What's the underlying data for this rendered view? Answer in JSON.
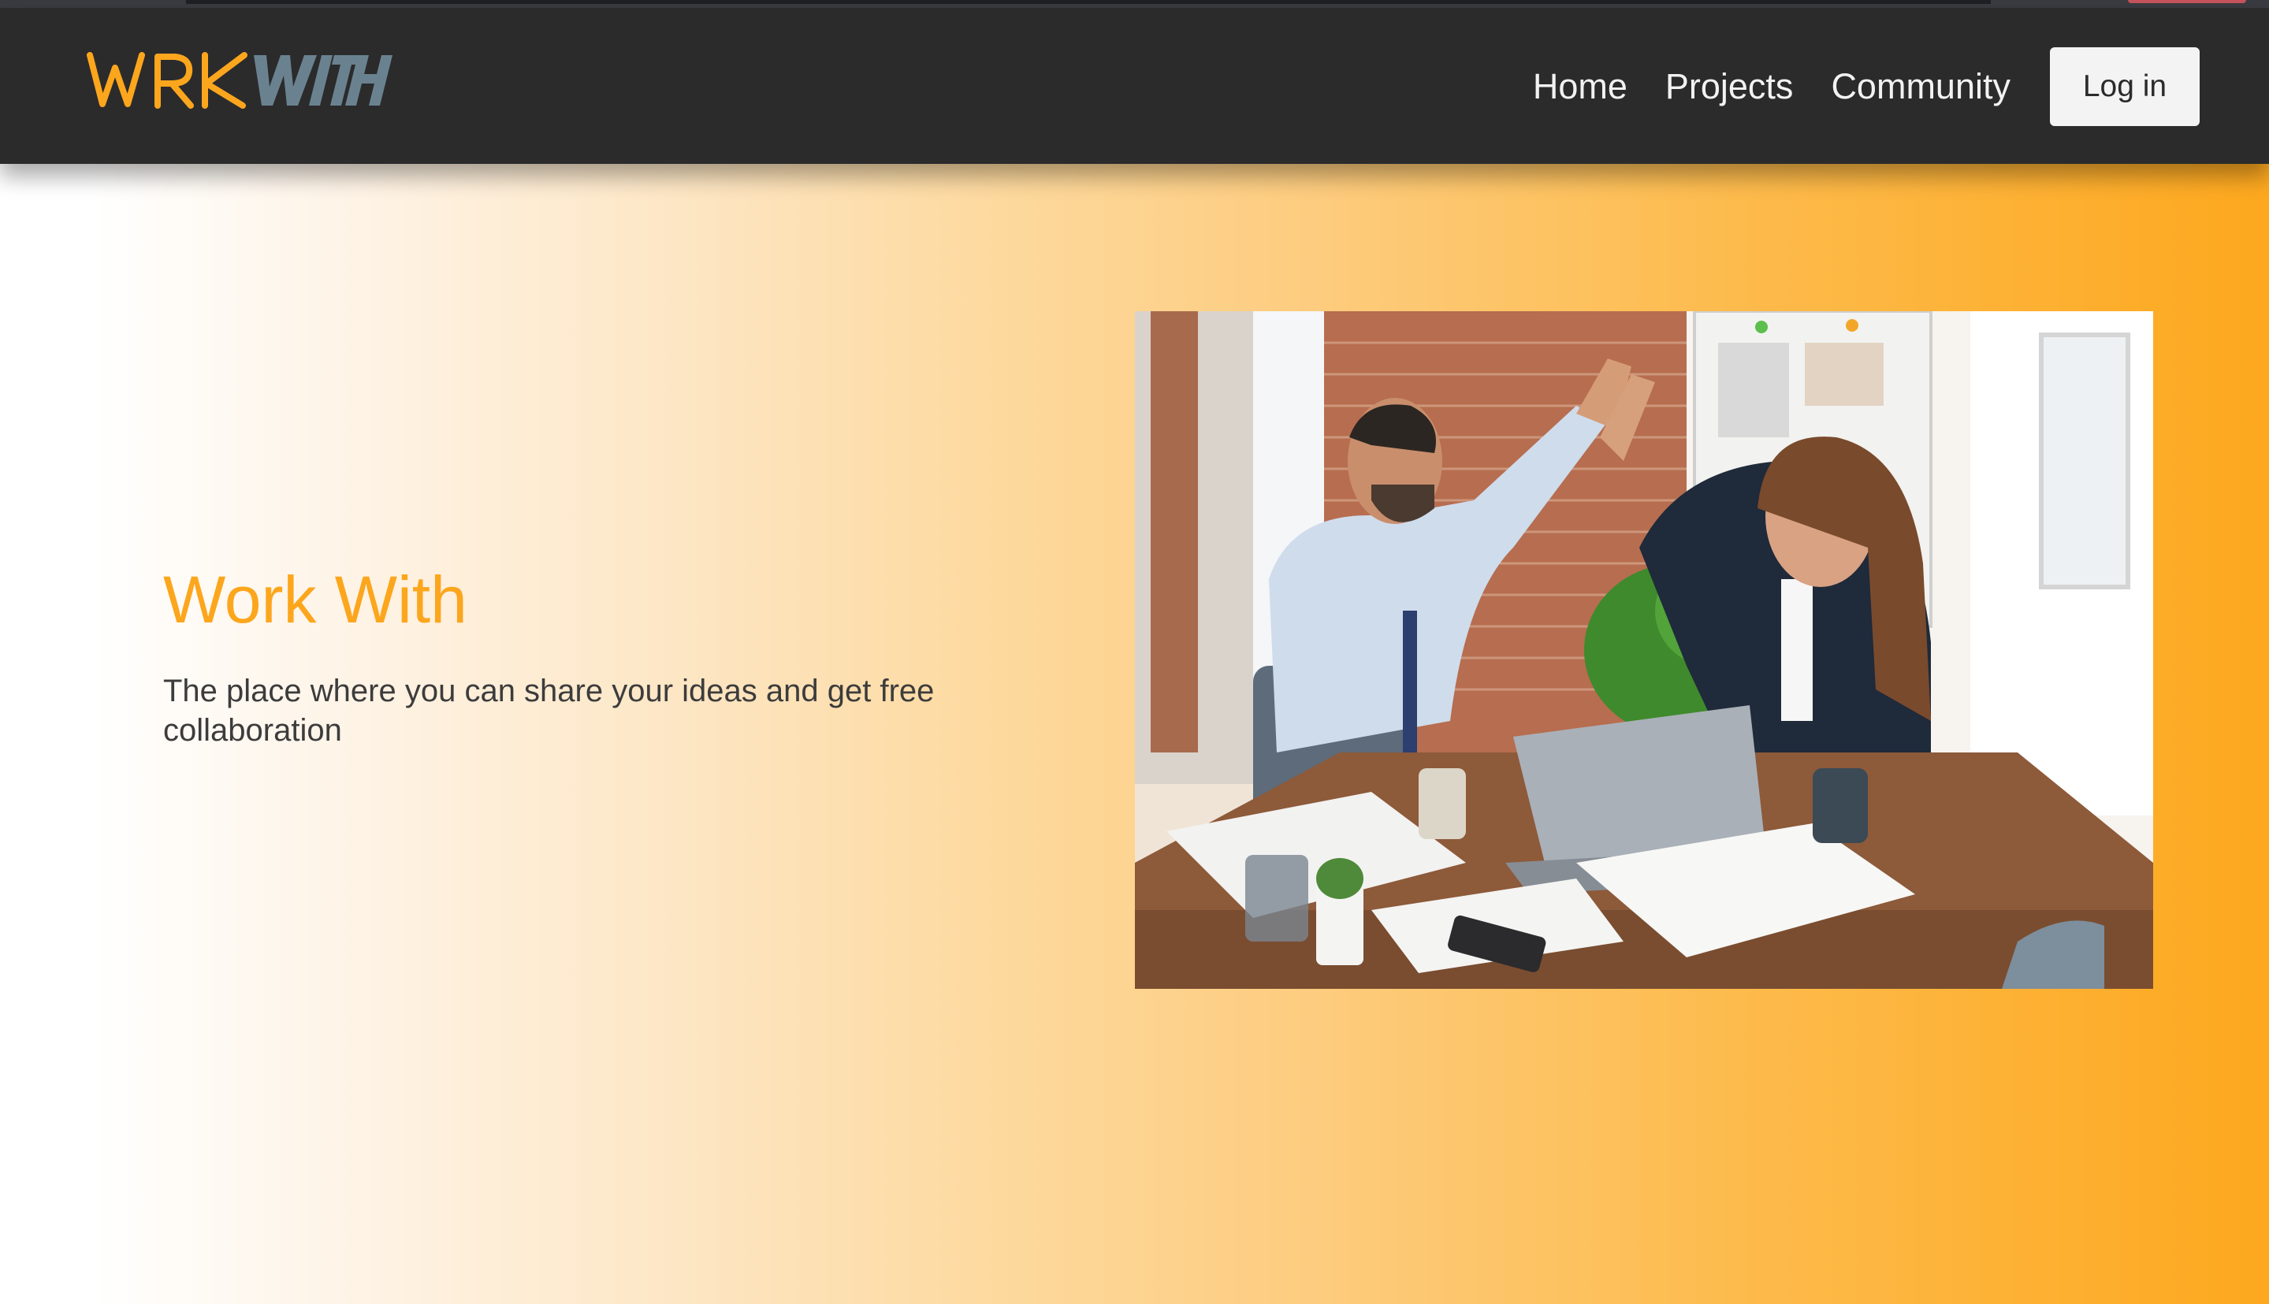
{
  "brand": {
    "logo_text": "WRKWITH",
    "logo_part1": "WRK",
    "logo_part2": "WITH",
    "color_primary": "#fca61d",
    "color_secondary": "#6a8290"
  },
  "nav": {
    "items": [
      {
        "label": "Home"
      },
      {
        "label": "Projects"
      },
      {
        "label": "Community"
      }
    ],
    "login_label": "Log in"
  },
  "hero": {
    "title": "Work With",
    "subtitle": "The place where you can share your ideas and get free collaboration",
    "image_icon": "office-high-five-photo"
  },
  "colors": {
    "header_bg": "#2b2b2c",
    "accent": "#fca61d",
    "gradient_end": "#fda81e"
  }
}
